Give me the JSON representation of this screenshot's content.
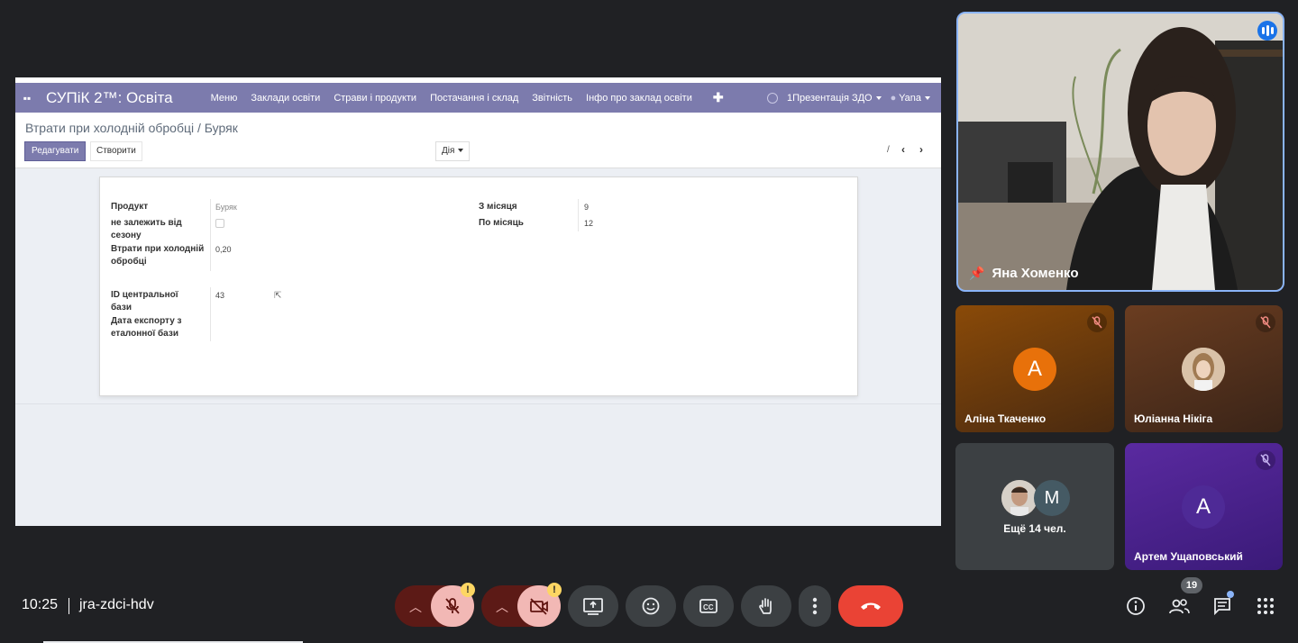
{
  "shared_screen": {
    "brand": "СУПіК 2™: Освіта",
    "menu": [
      "Меню",
      "Заклади освіти",
      "Страви і продукти",
      "Постачання і склад",
      "Звітність",
      "Інфо про заклад освіти"
    ],
    "company": "1Презентація ЗДО",
    "user": "Yana",
    "breadcrumb": "Втрати при холодній обробці / Буряк",
    "edit_label": "Редагувати",
    "create_label": "Створити",
    "action_label": "Дія",
    "pager_text": "/",
    "form": {
      "product_label": "Продукт",
      "product_value": "Буряк",
      "season_label": "не залежить від сезону",
      "loss_label": "Втрати при холодній обробці",
      "loss_value": "0,20",
      "from_month_label": "З місяця",
      "from_month_value": "9",
      "to_month_label": "По місяць",
      "to_month_value": "12",
      "central_id_label": "ID центральної бази",
      "central_id_value": "43",
      "export_date_label": "Дата експорту з еталонної бази"
    }
  },
  "participants": {
    "main": {
      "name": "Яна Хоменко"
    },
    "tiles": [
      {
        "name": "Аліна Ткаченко",
        "initial": "А",
        "color": "#e8710a"
      },
      {
        "name": "Юліанна Нікіга"
      },
      {
        "more_label": "Ещё 14 чел.",
        "initial": "M"
      },
      {
        "name": "Артем Ущаповський",
        "initial": "A",
        "color": "#4e2a96"
      }
    ]
  },
  "bottom_bar": {
    "time": "10:25",
    "meeting_code": "jra-zdci-hdv",
    "participants_count": "19"
  },
  "colors": {
    "accent": "#7c7bad",
    "end_call": "#ea4335",
    "background": "#202124"
  }
}
